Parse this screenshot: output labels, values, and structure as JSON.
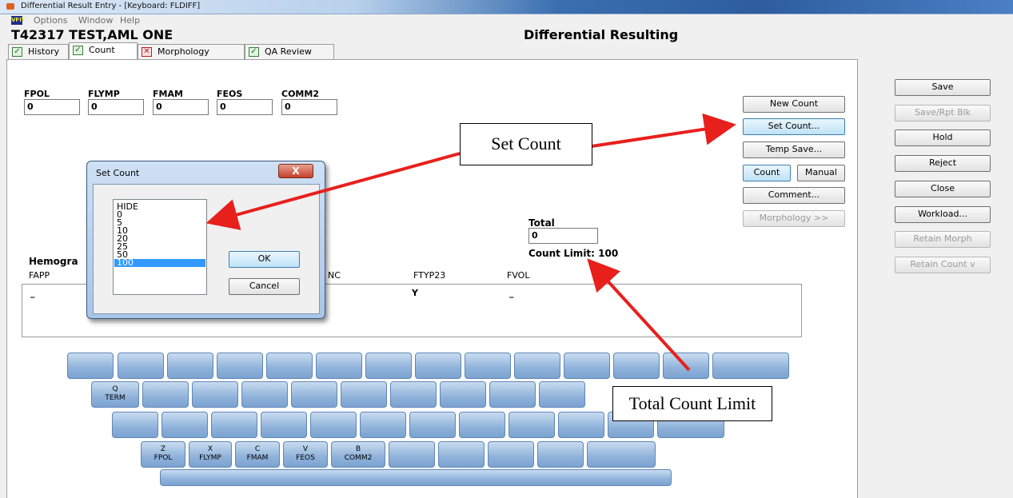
{
  "window": {
    "title": "Differential Result Entry - [Keyboard: FLDIFF]"
  },
  "menu": {
    "app_icon_text": "VFIT",
    "items": [
      "Options",
      "Window",
      "Help"
    ]
  },
  "header": {
    "patient": "T42317 TEST,AML ONE",
    "heading": "Differential Resulting"
  },
  "tabs": [
    {
      "label": "History",
      "state": "checked"
    },
    {
      "label": "Count",
      "state": "checked",
      "active": true
    },
    {
      "label": "Morphology",
      "state": "error"
    },
    {
      "label": "QA Review",
      "state": "checked"
    }
  ],
  "fields": [
    {
      "label": "FPOL",
      "value": "0"
    },
    {
      "label": "FLYMP",
      "value": "0"
    },
    {
      "label": "FMAM",
      "value": "0"
    },
    {
      "label": "FEOS",
      "value": "0"
    },
    {
      "label": "COMM2",
      "value": "0"
    }
  ],
  "count_buttons": {
    "new_count": "New Count",
    "set_count": "Set Count...",
    "temp_save": "Temp Save...",
    "count": "Count",
    "manual": "Manual",
    "comment": "Comment...",
    "morphology": "Morphology >>"
  },
  "total": {
    "label": "Total",
    "value": "0",
    "count_limit": "Count Limit: 100"
  },
  "hemogram": {
    "title": "Hemogra",
    "columns": [
      {
        "header": "FAPP",
        "value": "_"
      },
      {
        "header": "NC",
        "value": ""
      },
      {
        "header": "FTYP23",
        "value": "Y"
      },
      {
        "header": "FVOL",
        "value": "_"
      }
    ]
  },
  "side_buttons": [
    {
      "label": "Save",
      "enabled": true
    },
    {
      "label": "Save/Rpt Blk",
      "enabled": false
    },
    {
      "label": "Hold",
      "enabled": true
    },
    {
      "label": "Reject",
      "enabled": true
    },
    {
      "label": "Close",
      "enabled": true
    },
    {
      "label": "Workload...",
      "enabled": true
    },
    {
      "label": "Retain Morph",
      "enabled": false
    },
    {
      "label": "Retain Count v",
      "enabled": false
    }
  ],
  "keyboard": {
    "q_key": {
      "letter": "Q",
      "code": "TERM"
    },
    "bottom_row": [
      {
        "letter": "Z",
        "code": "FPOL"
      },
      {
        "letter": "X",
        "code": "FLYMP"
      },
      {
        "letter": "C",
        "code": "FMAM"
      },
      {
        "letter": "V",
        "code": "FEOS"
      },
      {
        "letter": "B",
        "code": "COMM2"
      }
    ]
  },
  "dialog": {
    "title": "Set Count",
    "close": "X",
    "options": [
      "HIDE",
      "0",
      "5",
      "10",
      "20",
      "25",
      "50",
      "100"
    ],
    "selected": "100",
    "ok": "OK",
    "cancel": "Cancel"
  },
  "annotations": {
    "set_count": "Set Count",
    "total_count_limit": "Total Count Limit"
  },
  "colors": {
    "arrow": "#e8201c",
    "selection": "#3399ff",
    "key_blue": "#8fb2da"
  }
}
